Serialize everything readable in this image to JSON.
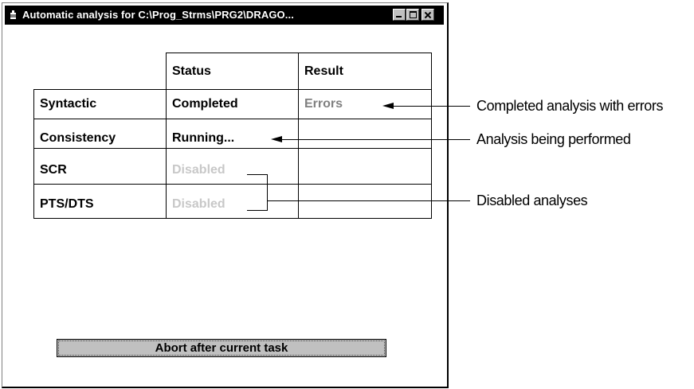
{
  "window": {
    "title": "Automatic analysis for C:\\Prog_Strms\\PRG2\\DRAGO..."
  },
  "table": {
    "headers": [
      "",
      "Status",
      "Result"
    ],
    "rows": [
      {
        "name": "Syntactic",
        "status": "Completed",
        "result": "Errors"
      },
      {
        "name": "Consistency",
        "status": "Running...",
        "result": ""
      },
      {
        "name": "SCR",
        "status": "Disabled",
        "result": ""
      },
      {
        "name": "PTS/DTS",
        "status": "Disabled",
        "result": ""
      }
    ]
  },
  "abort_button": {
    "label": "Abort after current task"
  },
  "callouts": {
    "errors": "Completed analysis with errors",
    "running": "Analysis being performed",
    "disabled": "Disabled analyses"
  }
}
